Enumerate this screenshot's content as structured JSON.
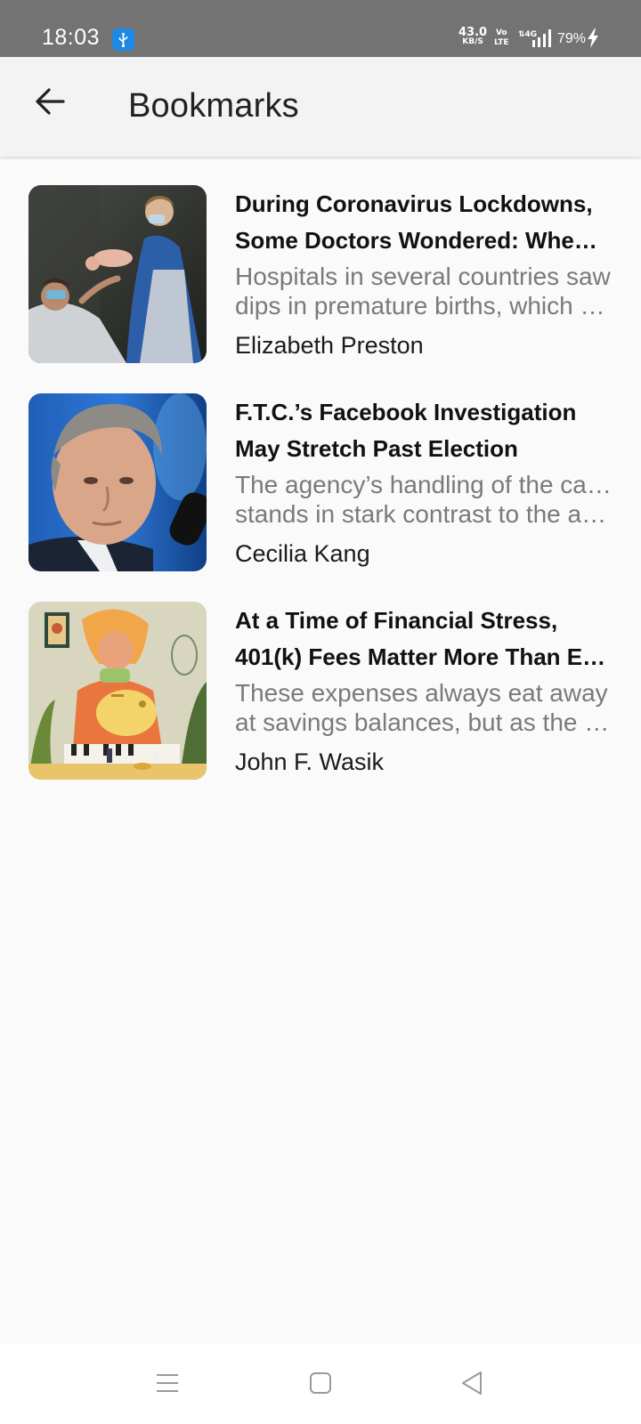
{
  "status_bar": {
    "time": "18:03",
    "net_speed": "43.0",
    "net_speed_unit": "KB/S",
    "volte_top": "Vo",
    "volte_bottom": "LTE",
    "battery": "79%",
    "icons": [
      "usb-icon",
      "signal-4g-icon",
      "charging-icon"
    ]
  },
  "app_bar": {
    "title": "Bookmarks",
    "back_icon": "arrow-back-icon"
  },
  "bookmarks": [
    {
      "title_line1": "During Coronavirus Lockdowns,",
      "title_line2": "Some Doctors Wondered: Whe…",
      "summary_line1": "Hospitals in several countries saw",
      "summary_line2": "dips in premature births, which c…",
      "author": "Elizabeth Preston",
      "image": "doctors-newborn-photo"
    },
    {
      "title_line1": "F.T.C.’s Facebook Investigation",
      "title_line2": "May Stretch Past Election",
      "summary_line1": "The agency’s handling of the case",
      "summary_line2": "stands in stark contrast to the an…",
      "author": "Cecilia Kang",
      "image": "man-portrait-photo"
    },
    {
      "title_line1": "At a Time of Financial Stress,",
      "title_line2": "401(k) Fees Matter More Than E…",
      "summary_line1": "These expenses always eat away",
      "summary_line2": "at savings balances, but as the p…",
      "author": "John F. Wasik",
      "image": "piggy-bank-illustration"
    }
  ],
  "nav_bar": {
    "icons": [
      "menu-icon",
      "home-square-icon",
      "back-triangle-icon"
    ]
  },
  "colors": {
    "status_bar_bg": "#737373",
    "app_bar_bg": "#f3f3f3",
    "page_bg": "#fafafa",
    "usb_badge": "#1e88e5",
    "summary_text": "#7a7a7a"
  }
}
